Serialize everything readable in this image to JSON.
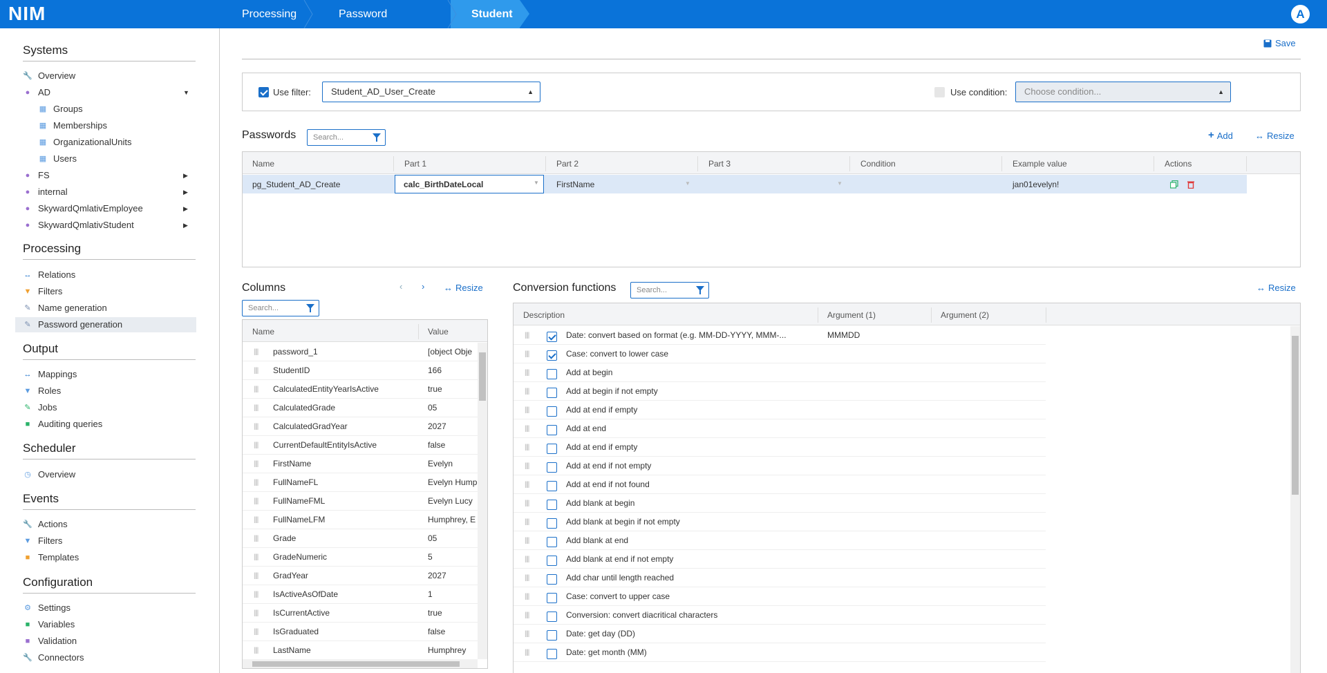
{
  "app": {
    "logo": "NIM",
    "avatar": "A"
  },
  "breadcrumb": [
    "Processing",
    "Password generation",
    "Student"
  ],
  "sidebar": {
    "sections": [
      {
        "title": "Systems"
      },
      {
        "title": "Processing"
      },
      {
        "title": "Output"
      },
      {
        "title": "Scheduler"
      },
      {
        "title": "Events"
      },
      {
        "title": "Configuration"
      }
    ],
    "items": [
      {
        "label": "Overview",
        "icon": "wrench-icon"
      },
      {
        "label": "AD",
        "icon": "users-icon"
      },
      {
        "label": "Groups",
        "icon": "table-icon"
      },
      {
        "label": "Memberships",
        "icon": "table-icon"
      },
      {
        "label": "OrganizationalUnits",
        "icon": "table-icon"
      },
      {
        "label": "Users",
        "icon": "table-icon"
      },
      {
        "label": "FS",
        "icon": "users-icon"
      },
      {
        "label": "internal",
        "icon": "users-icon"
      },
      {
        "label": "SkywardQmlativEmployee",
        "icon": "users-icon"
      },
      {
        "label": "SkywardQmlativStudent",
        "icon": "users-icon"
      },
      {
        "label": "Relations",
        "icon": "arrows-icon"
      },
      {
        "label": "Filters",
        "icon": "funnel-icon"
      },
      {
        "label": "Name generation",
        "icon": "edit-icon"
      },
      {
        "label": "Password generation",
        "icon": "edit-icon"
      },
      {
        "label": "Mappings",
        "icon": "arrows-icon"
      },
      {
        "label": "Roles",
        "icon": "funnel-icon"
      },
      {
        "label": "Jobs",
        "icon": "edit-icon"
      },
      {
        "label": "Auditing queries",
        "icon": "doc-icon"
      },
      {
        "label": "Overview",
        "icon": "clock-icon"
      },
      {
        "label": "Actions",
        "icon": "wrench-icon"
      },
      {
        "label": "Filters",
        "icon": "funnel-icon"
      },
      {
        "label": "Templates",
        "icon": "doc-icon"
      },
      {
        "label": "Settings",
        "icon": "gear-icon"
      },
      {
        "label": "Variables",
        "icon": "doc-icon"
      },
      {
        "label": "Validation",
        "icon": "doc-icon"
      },
      {
        "label": "Connectors",
        "icon": "wrench-icon"
      }
    ]
  },
  "toolbar": {
    "save_label": "Save"
  },
  "filter": {
    "use_filter_label": "Use filter:",
    "filter_value": "Student_AD_User_Create",
    "use_condition_label": "Use condition:",
    "condition_placeholder": "Choose condition..."
  },
  "passwords": {
    "title": "Passwords",
    "search_placeholder": "Search...",
    "add_label": "Add",
    "resize_label": "Resize",
    "columns": [
      "Name",
      "Part 1",
      "Part 2",
      "Part 3",
      "Condition",
      "Example value",
      "Actions"
    ],
    "row": {
      "name": "pg_Student_AD_Create",
      "part1": "calc_BirthDateLocal",
      "part2": "FirstName",
      "part3": "",
      "condition": "",
      "example": "jan01evelyn!"
    }
  },
  "columns_panel": {
    "title": "Columns",
    "search_placeholder": "Search...",
    "resize_label": "Resize",
    "headers": [
      "Name",
      "Value"
    ],
    "rows": [
      {
        "name": "password_1",
        "value": "[object Obje"
      },
      {
        "name": "StudentID",
        "value": "166"
      },
      {
        "name": "CalculatedEntityYearIsActive",
        "value": "true"
      },
      {
        "name": "CalculatedGrade",
        "value": "05"
      },
      {
        "name": "CalculatedGradYear",
        "value": "2027"
      },
      {
        "name": "CurrentDefaultEntityIsActive",
        "value": "false"
      },
      {
        "name": "FirstName",
        "value": "Evelyn"
      },
      {
        "name": "FullNameFL",
        "value": "Evelyn Hump"
      },
      {
        "name": "FullNameFML",
        "value": "Evelyn Lucy"
      },
      {
        "name": "FullNameLFM",
        "value": "Humphrey, E"
      },
      {
        "name": "Grade",
        "value": "05"
      },
      {
        "name": "GradeNumeric",
        "value": "5"
      },
      {
        "name": "GradYear",
        "value": "2027"
      },
      {
        "name": "IsActiveAsOfDate",
        "value": "1"
      },
      {
        "name": "IsCurrentActive",
        "value": "true"
      },
      {
        "name": "IsGraduated",
        "value": "false"
      },
      {
        "name": "LastName",
        "value": "Humphrey"
      }
    ]
  },
  "conversion": {
    "title": "Conversion functions",
    "search_placeholder": "Search...",
    "resize_label": "Resize",
    "headers": [
      "Description",
      "Argument (1)",
      "Argument (2)"
    ],
    "rows": [
      {
        "desc": "Date: convert based on format (e.g. MM-DD-YYYY, MMM-...",
        "arg1": "MMMDD",
        "checked": true
      },
      {
        "desc": "Case: convert to lower case",
        "arg1": "",
        "checked": true
      },
      {
        "desc": "Add at begin",
        "arg1": "",
        "checked": false
      },
      {
        "desc": "Add at begin if not empty",
        "arg1": "",
        "checked": false
      },
      {
        "desc": "Add at end if empty",
        "arg1": "",
        "checked": false
      },
      {
        "desc": "Add at end",
        "arg1": "",
        "checked": false
      },
      {
        "desc": "Add at end if empty",
        "arg1": "",
        "checked": false
      },
      {
        "desc": "Add at end if not empty",
        "arg1": "",
        "checked": false
      },
      {
        "desc": "Add at end if not found",
        "arg1": "",
        "checked": false
      },
      {
        "desc": "Add blank at begin",
        "arg1": "",
        "checked": false
      },
      {
        "desc": "Add blank at begin if not empty",
        "arg1": "",
        "checked": false
      },
      {
        "desc": "Add blank at end",
        "arg1": "",
        "checked": false
      },
      {
        "desc": "Add blank at end if not empty",
        "arg1": "",
        "checked": false
      },
      {
        "desc": "Add char until length reached",
        "arg1": "",
        "checked": false
      },
      {
        "desc": "Case: convert to upper case",
        "arg1": "",
        "checked": false
      },
      {
        "desc": "Conversion: convert diacritical characters",
        "arg1": "",
        "checked": false
      },
      {
        "desc": "Date: get day (DD)",
        "arg1": "",
        "checked": false
      },
      {
        "desc": "Date: get month (MM)",
        "arg1": "",
        "checked": false
      }
    ]
  },
  "colors": {
    "brand": "#0a73d9",
    "accent": "#1a6fc9",
    "active_crumb": "#2f9aec",
    "selected_row": "#dce8f7"
  }
}
